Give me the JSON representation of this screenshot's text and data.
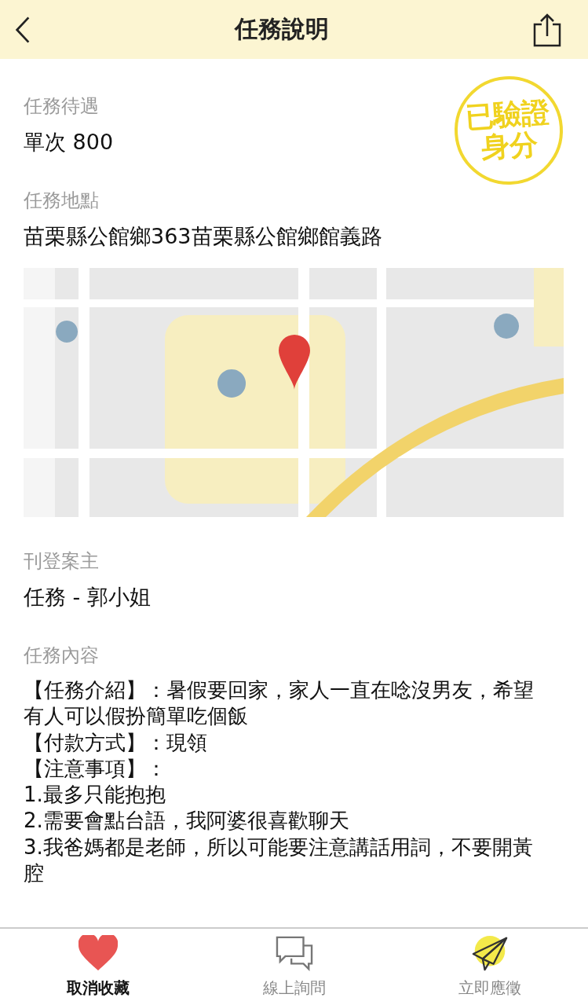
{
  "header": {
    "title": "任務說明"
  },
  "stamp": {
    "lines": [
      "已驗證",
      "身分"
    ]
  },
  "fields": [
    {
      "label": "任務待遇",
      "value": "單次 800"
    },
    {
      "label": "任務地點",
      "value": "苗栗縣公館鄉363苗栗縣公館鄉館義路"
    },
    {
      "label": "刊登案主",
      "value": "任務 - 郭小姐"
    },
    {
      "label": "任務內容",
      "lines": [
        "【任務介紹】：暑假要回家，家人一直在唸沒男友，希望有人可以假扮簡單吃個飯",
        "【付款方式】：現領",
        "【注意事項】：",
        "1.最多只能抱抱",
        "2.需要會點台語，我阿婆很喜歡聊天",
        "3.我爸媽都是老師，所以可能要注意講話用詞，不要開黃腔"
      ]
    }
  ],
  "actions": [
    {
      "kind": "heart",
      "label": "取消收藏",
      "selected": true
    },
    {
      "kind": "chat",
      "label": "線上詢問",
      "selected": false
    },
    {
      "kind": "plane",
      "label": "立即應徵",
      "selected": false
    }
  ]
}
